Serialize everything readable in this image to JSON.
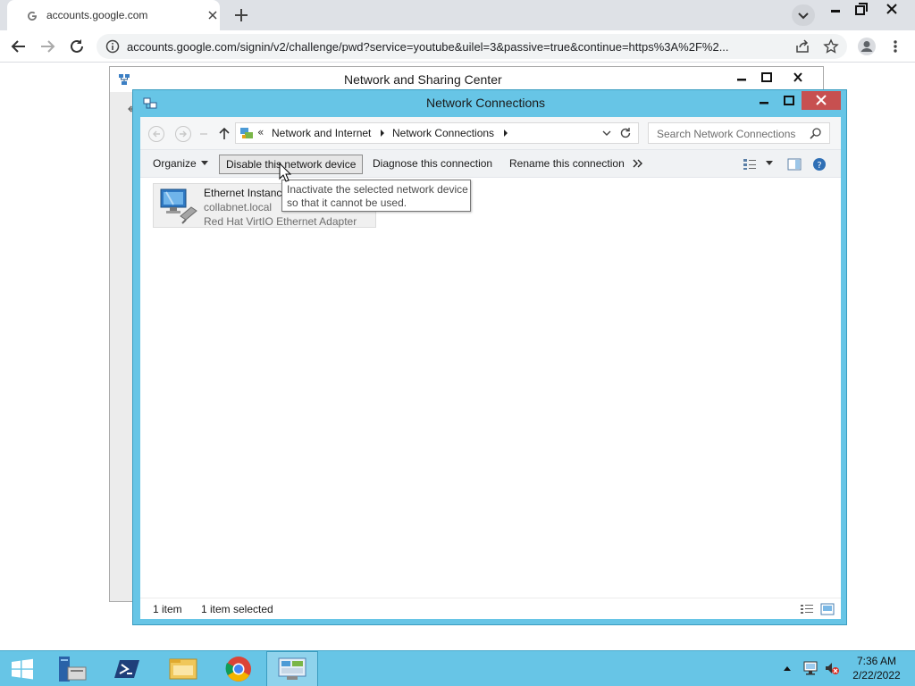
{
  "browser": {
    "tab_title": "accounts.google.com",
    "url": "accounts.google.com/signin/v2/challenge/pwd?service=youtube&uilel=3&passive=true&continue=https%3A%2F%2..."
  },
  "background_window": {
    "title": "Network and Sharing Center"
  },
  "network_connections": {
    "title": "Network Connections",
    "address": {
      "overflow": "«",
      "crumbs": [
        "Network and Internet",
        "Network Connections"
      ]
    },
    "search_placeholder": "Search Network Connections",
    "commands": {
      "organize": "Organize",
      "disable": "Disable this network device",
      "diagnose": "Diagnose this connection",
      "rename": "Rename this connection"
    },
    "tooltip": {
      "line1": "Inactivate the selected network device",
      "line2": "so that it cannot be used."
    },
    "connection": {
      "name": "Ethernet Instanc",
      "domain": "collabnet.local",
      "adapter": "Red Hat VirtIO Ethernet Adapter"
    },
    "status": {
      "count": "1 item",
      "selected": "1 item selected"
    }
  },
  "taskbar": {
    "apps": [
      "server-manager",
      "powershell",
      "file-explorer",
      "chrome",
      "network-connections"
    ],
    "clock_time": "7:36 AM",
    "clock_date": "2/22/2022"
  },
  "colors": {
    "window_frame": "#67c5e6",
    "close_button": "#c75050",
    "taskbar": "#67c5e6",
    "chrome_tabstrip": "#dee1e6"
  }
}
